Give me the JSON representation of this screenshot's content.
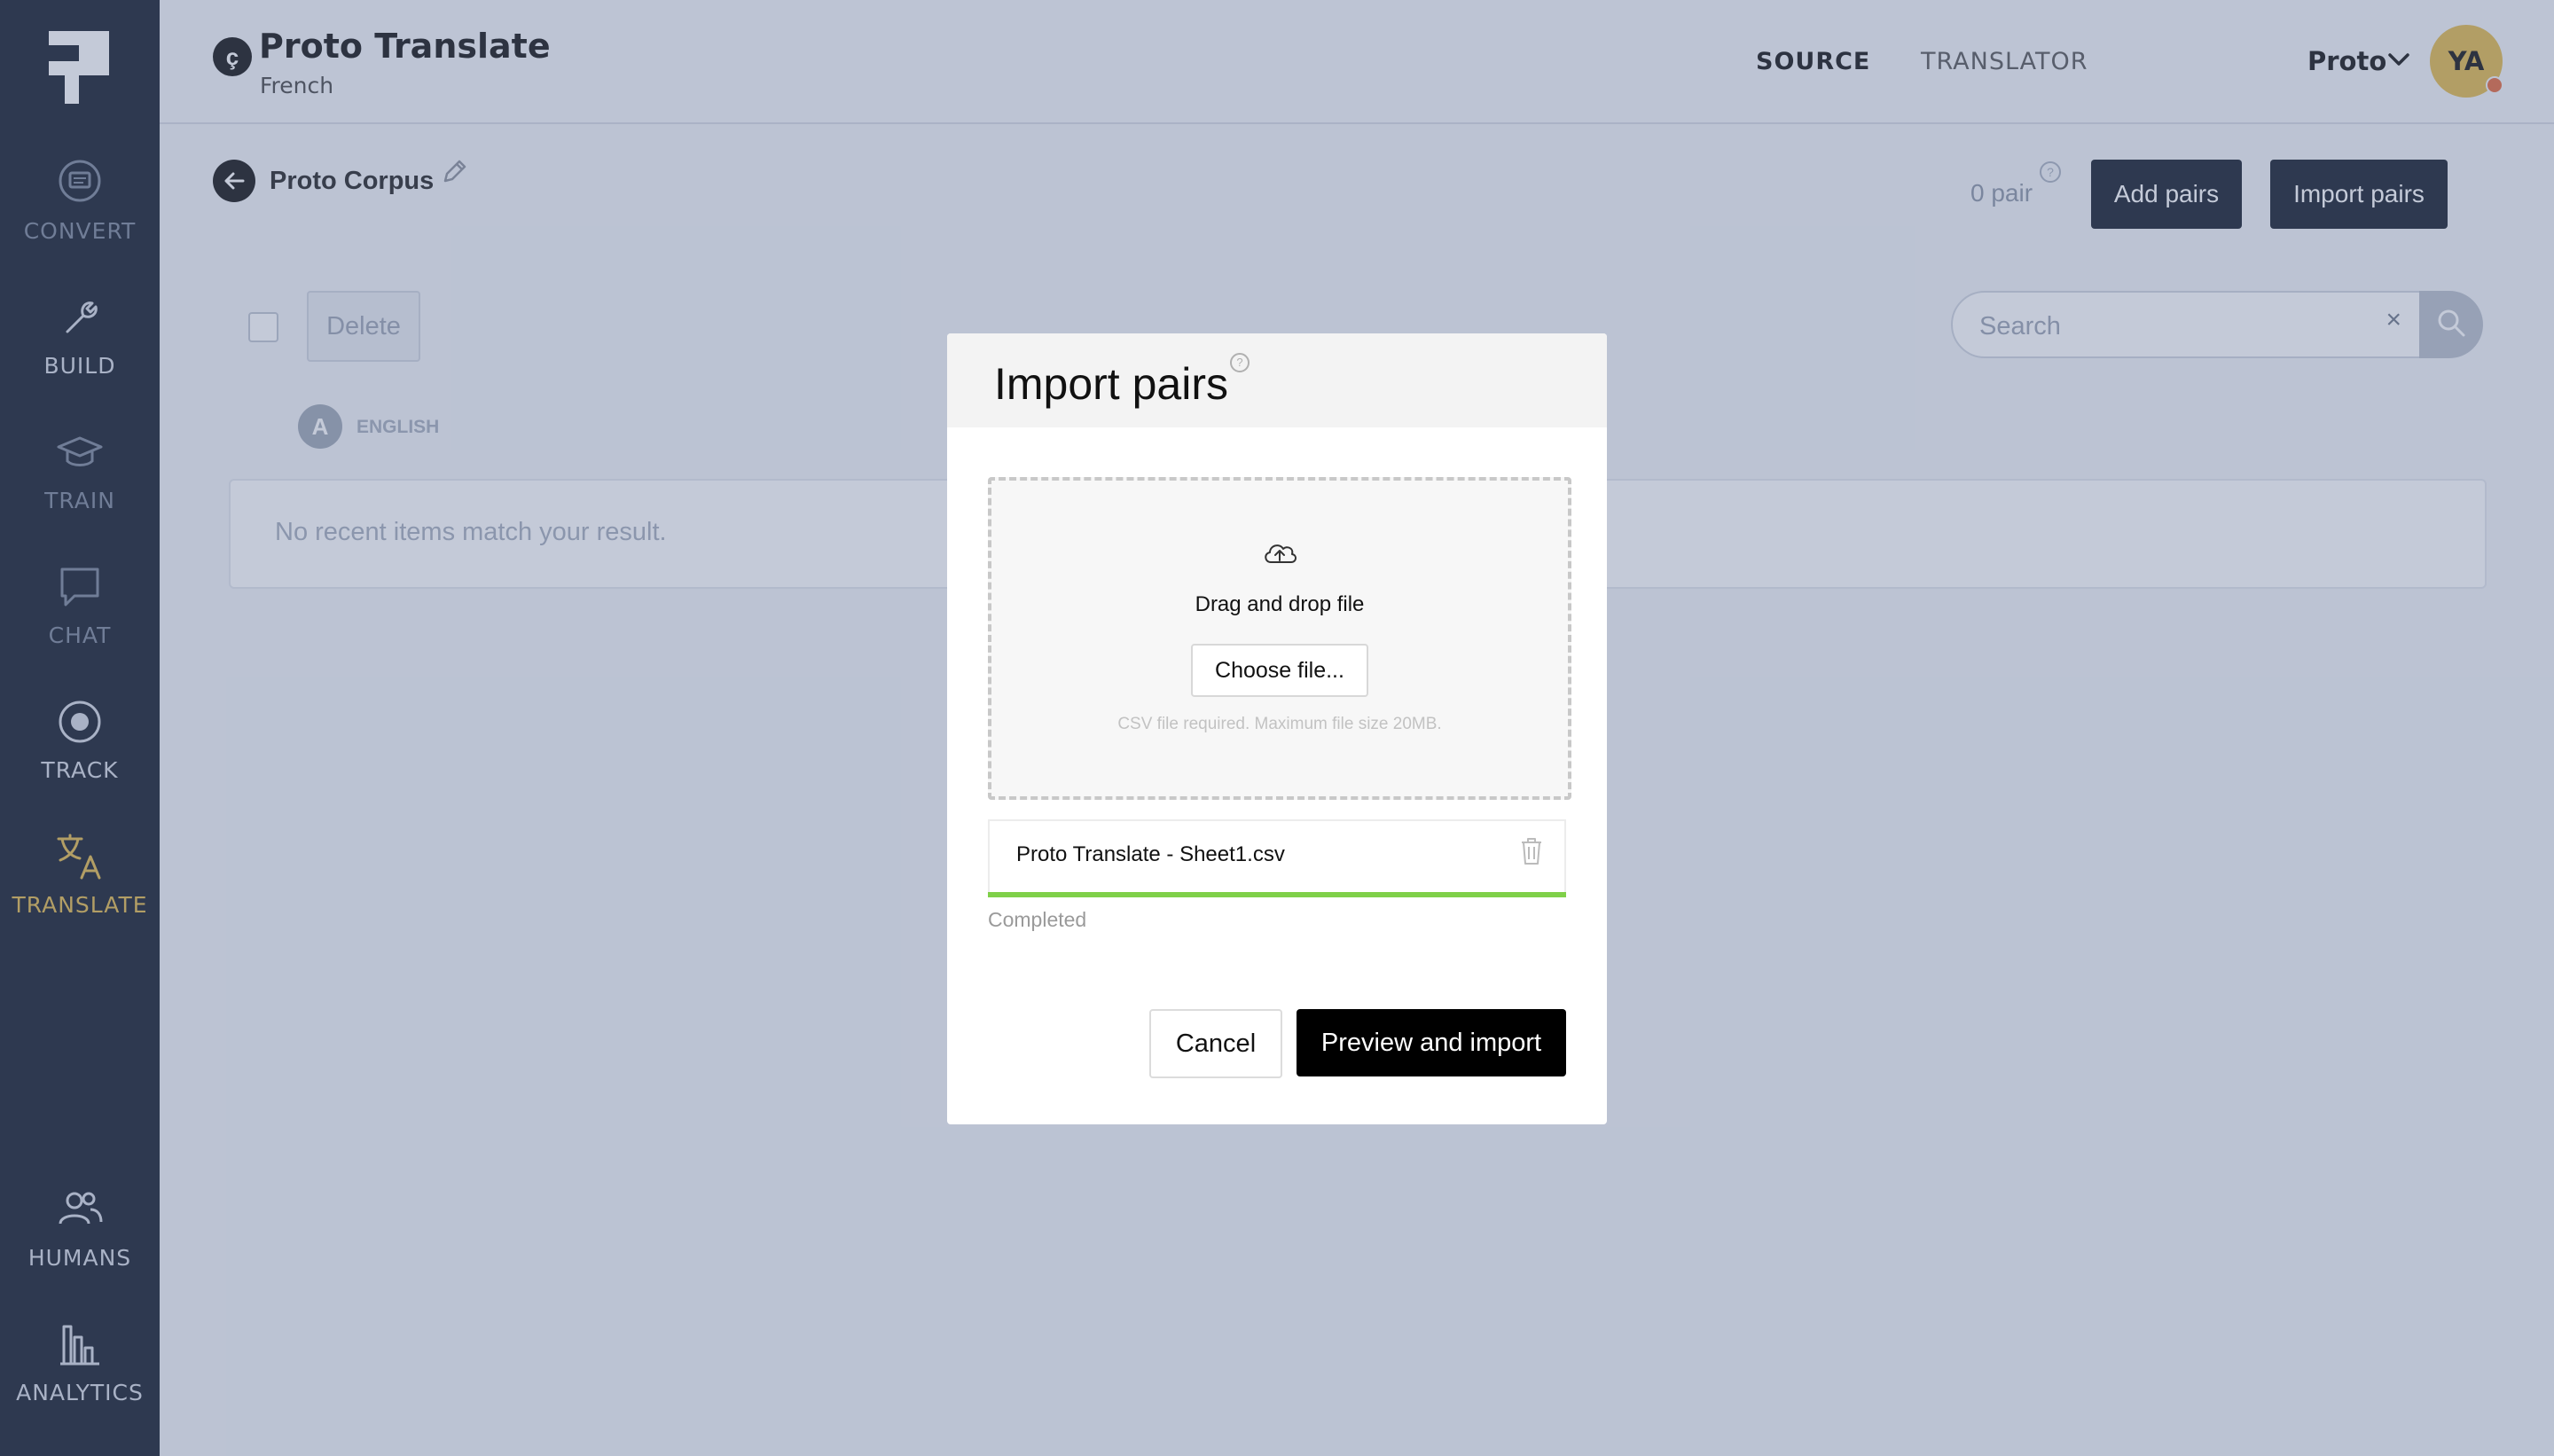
{
  "header": {
    "project_badge": "ç",
    "project_title": "Proto Translate",
    "project_subtitle": "French",
    "tabs": [
      {
        "label": "SOURCE",
        "active": true
      },
      {
        "label": "TRANSLATOR",
        "active": false
      }
    ],
    "user_menu": "Proto",
    "avatar_initials": "YA",
    "avatar_color": "#e2b94a",
    "status_dot_color": "#e6683a"
  },
  "sidebar": {
    "items": [
      {
        "label": "CONVERT",
        "icon": "chat-bubble-icon"
      },
      {
        "label": "BUILD",
        "icon": "wrench-icon"
      },
      {
        "label": "TRAIN",
        "icon": "graduation-cap-icon"
      },
      {
        "label": "CHAT",
        "icon": "chat-icon"
      },
      {
        "label": "TRACK",
        "icon": "target-icon"
      },
      {
        "label": "TRANSLATE",
        "icon": "translate-icon",
        "active": true
      },
      {
        "label": "HUMANS",
        "icon": "users-icon"
      },
      {
        "label": "ANALYTICS",
        "icon": "bar-chart-icon"
      }
    ],
    "accent_color": "#e2b94a"
  },
  "corpus": {
    "title": "Proto Corpus",
    "pair_count": "0 pair",
    "add_label": "Add pairs",
    "import_label": "Import pairs",
    "delete_label": "Delete",
    "search_placeholder": "Search",
    "search_clear": "×",
    "language_badge": "A",
    "language_label": "ENGLISH",
    "empty_message": "No recent items match your result."
  },
  "modal": {
    "title": "Import pairs",
    "help": "?",
    "drop_label": "Drag and drop file",
    "choose_label": "Choose file...",
    "hint": "CSV file required. Maximum file size 20MB.",
    "file_name": "Proto Translate - Sheet1.csv",
    "file_progress": 1.0,
    "file_status": "Completed",
    "progress_color": "#7fd049",
    "cancel_label": "Cancel",
    "confirm_label": "Preview and import"
  }
}
